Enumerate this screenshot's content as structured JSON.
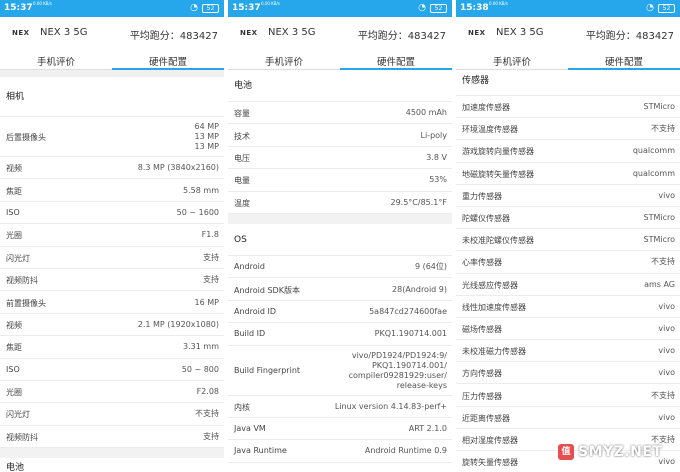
{
  "panels": [
    {
      "status": {
        "time": "15:37",
        "net": "0.00 KB/s",
        "wifi_icon": "wifi-icon",
        "battery": "52"
      },
      "header": {
        "logo": "NEX",
        "model": "NEX 3 5G",
        "score": "平均跑分：483427"
      },
      "tabs": [
        "手机评价",
        "硬件配置"
      ],
      "section": "相机",
      "rows": [
        {
          "k": "后置摄像头",
          "v": "64 MP\n13 MP\n13 MP"
        },
        {
          "k": "视频",
          "v": "8.3 MP (3840x2160)"
        },
        {
          "k": "焦距",
          "v": "5.58 mm"
        },
        {
          "k": "ISO",
          "v": "50 ~ 1600"
        },
        {
          "k": "光圈",
          "v": "F1.8"
        },
        {
          "k": "闪光灯",
          "v": "支持"
        },
        {
          "k": "视频防抖",
          "v": "支持"
        },
        {
          "k": "前置摄像头",
          "v": "16 MP"
        },
        {
          "k": "视频",
          "v": "2.1 MP (1920x1080)"
        },
        {
          "k": "焦距",
          "v": "3.31 mm"
        },
        {
          "k": "ISO",
          "v": "50 ~ 800"
        },
        {
          "k": "光圈",
          "v": "F2.08"
        },
        {
          "k": "闪光灯",
          "v": "不支持"
        },
        {
          "k": "视频防抖",
          "v": "支持"
        }
      ],
      "next_section": "电池"
    },
    {
      "status": {
        "time": "15:37",
        "net": "0.00 KB/s",
        "wifi_icon": "wifi-icon",
        "battery": "52"
      },
      "header": {
        "logo": "NEX",
        "model": "NEX 3 5G",
        "score": "平均跑分：483427"
      },
      "tabs": [
        "手机评价",
        "硬件配置"
      ],
      "section": "电池",
      "rows": [
        {
          "k": "容量",
          "v": "4500 mAh"
        },
        {
          "k": "技术",
          "v": "Li-poly"
        },
        {
          "k": "电压",
          "v": "3.8 V"
        },
        {
          "k": "电量",
          "v": "53%"
        },
        {
          "k": "温度",
          "v": "29.5°C/85.1°F"
        }
      ],
      "section2": "OS",
      "rows2": [
        {
          "k": "Android",
          "v": "9 (64位)"
        },
        {
          "k": "Android SDK版本",
          "v": "28(Android 9)"
        },
        {
          "k": "Android ID",
          "v": "5a847cd274600fae"
        },
        {
          "k": "Build ID",
          "v": "PKQ1.190714.001"
        },
        {
          "k": "Build Fingerprint",
          "v": "vivo/PD1924/PD1924:9/\nPKQ1.190714.001/\ncompiler09281929:user/\nrelease-keys"
        },
        {
          "k": "内核",
          "v": "Linux version 4.14.83-perf+"
        },
        {
          "k": "Java VM",
          "v": "ART 2.1.0"
        },
        {
          "k": "Java Runtime",
          "v": "Android Runtime 0.9"
        }
      ]
    },
    {
      "status": {
        "time": "15:38",
        "net": "0.00 KB/s",
        "wifi_icon": "wifi-icon",
        "battery": "52"
      },
      "header": {
        "logo": "NEX",
        "model": "NEX 3 5G",
        "score": "平均跑分：483427"
      },
      "tabs": [
        "手机评价",
        "硬件配置"
      ],
      "section": "传感器",
      "rows": [
        {
          "k": "加速度传感器",
          "v": "STMicro"
        },
        {
          "k": "环境温度传感器",
          "v": "不支持"
        },
        {
          "k": "游戏旋转向量传感器",
          "v": "qualcomm"
        },
        {
          "k": "地磁旋转矢量传感器",
          "v": "qualcomm"
        },
        {
          "k": "重力传感器",
          "v": "vivo"
        },
        {
          "k": "陀螺仪传感器",
          "v": "STMicro"
        },
        {
          "k": "未校准陀螺仪传感器",
          "v": "STMicro"
        },
        {
          "k": "心率传感器",
          "v": "不支持"
        },
        {
          "k": "光线感应传感器",
          "v": "ams AG"
        },
        {
          "k": "线性加速度传感器",
          "v": "vivo"
        },
        {
          "k": "磁场传感器",
          "v": "vivo"
        },
        {
          "k": "未校准磁力传感器",
          "v": "vivo"
        },
        {
          "k": "方向传感器",
          "v": "vivo"
        },
        {
          "k": "压力传感器",
          "v": "不支持"
        },
        {
          "k": "近距离传感器",
          "v": "vivo"
        },
        {
          "k": "相对湿度传感器",
          "v": "不支持"
        },
        {
          "k": "旋转矢量传感器",
          "v": "vivo"
        }
      ]
    }
  ],
  "watermark": {
    "icon": "值",
    "text": "SMYZ.NET"
  },
  "accent": "#26a7ec"
}
